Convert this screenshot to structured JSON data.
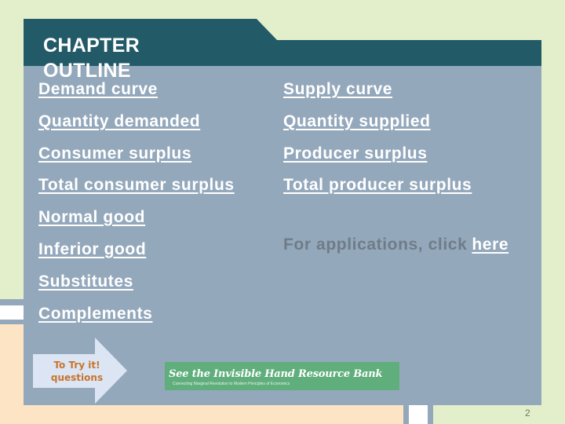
{
  "header": {
    "title_line1": "CHAPTER",
    "title_line2": "OUTLINE"
  },
  "outline": {
    "left_column": [
      {
        "label": "Demand curve"
      },
      {
        "label": "Quantity demanded"
      },
      {
        "label": "Consumer surplus"
      },
      {
        "label": "Total consumer surplus"
      },
      {
        "label": "Normal good"
      },
      {
        "label": "Inferior good"
      },
      {
        "label": "Substitutes"
      },
      {
        "label": "Complements"
      }
    ],
    "right_column": [
      {
        "label": "Supply curve"
      },
      {
        "label": "Quantity supplied"
      },
      {
        "label": "Producer surplus"
      },
      {
        "label": "Total producer surplus"
      }
    ]
  },
  "applications": {
    "text": "For applications, click",
    "link_label": "here"
  },
  "try_it": {
    "line1": "To Try it!",
    "line2": "questions"
  },
  "resource_bank": {
    "title": "See the Invisible Hand Resource Bank",
    "subtitle": "Connecting Marginal Revolution to Modern Principles of Economics"
  },
  "footer": {
    "page_number": "2"
  },
  "colors": {
    "background": "#e2efca",
    "header": "#235a68",
    "panel": "#94a8bc",
    "peach": "#fde4c4",
    "banner": "#5fae7c",
    "try_text": "#c8742c"
  }
}
